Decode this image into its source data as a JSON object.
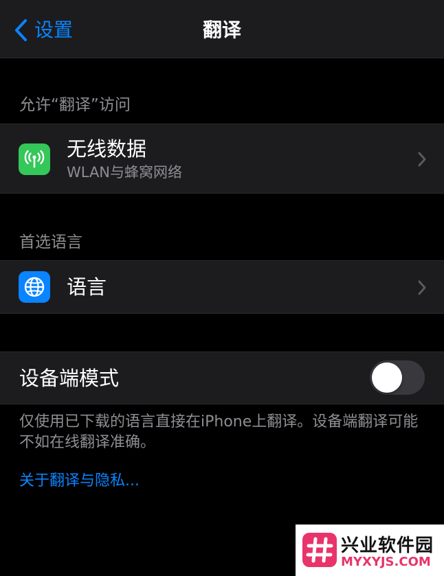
{
  "navbar": {
    "back_label": "设置",
    "title": "翻译"
  },
  "sections": {
    "access": {
      "header": "允许“翻译”访问",
      "row": {
        "title": "无线数据",
        "subtitle": "WLAN与蜂窝网络",
        "icon": "antenna-icon"
      }
    },
    "preferred_language": {
      "header": "首选语言",
      "row": {
        "title": "语言",
        "icon": "globe-icon"
      }
    },
    "on_device": {
      "label": "设备端模式",
      "toggle_on": false,
      "footer": "仅使用已下载的语言直接在iPhone上翻译。设备端翻译可能不如在线翻译准确。",
      "link": "关于翻译与隐私..."
    }
  },
  "watermark": {
    "name": "兴业软件园",
    "url": "MYXYJS.COM"
  },
  "colors": {
    "background": "#000000",
    "cell": "#1c1c1e",
    "accent": "#0a84ff",
    "secondary_text": "#8e8e93",
    "wireless_icon_bg": "#34c759",
    "language_icon_bg": "#0a84ff",
    "watermark_accent": "#e8346b"
  }
}
